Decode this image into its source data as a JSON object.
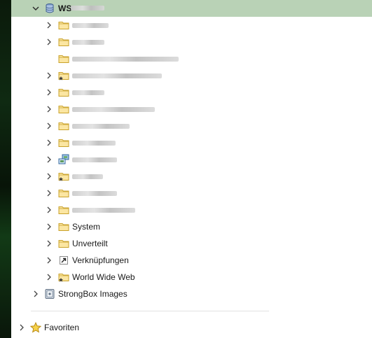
{
  "tree": {
    "root": {
      "label": "WS",
      "icon": "database-icon",
      "expanded": true
    },
    "children": [
      {
        "icon": "folder-icon",
        "has_chevron": true
      },
      {
        "icon": "folder-icon",
        "has_chevron": true
      },
      {
        "icon": "folder-icon",
        "has_chevron": false
      },
      {
        "icon": "folder-starred-icon",
        "has_chevron": true
      },
      {
        "icon": "folder-icon",
        "has_chevron": true
      },
      {
        "icon": "folder-icon",
        "has_chevron": true
      },
      {
        "icon": "folder-icon",
        "has_chevron": true
      },
      {
        "icon": "folder-icon",
        "has_chevron": true
      },
      {
        "icon": "network-icon",
        "has_chevron": true
      },
      {
        "icon": "folder-starred-icon",
        "has_chevron": true
      },
      {
        "icon": "folder-icon",
        "has_chevron": true
      },
      {
        "icon": "folder-icon",
        "has_chevron": true
      },
      {
        "label": "System",
        "icon": "folder-icon",
        "has_chevron": true
      },
      {
        "label": "Unverteilt",
        "icon": "folder-icon",
        "has_chevron": true
      },
      {
        "label": "Verknüpfungen",
        "icon": "shortcut-icon",
        "has_chevron": true
      },
      {
        "label": "World Wide Web",
        "icon": "folder-starred-icon",
        "has_chevron": true
      }
    ],
    "images": {
      "label": "StrongBox Images",
      "icon": "strongbox-icon"
    },
    "favorites": {
      "label": "Favoriten",
      "icon": "star-icon"
    }
  },
  "colors": {
    "selection": "#b9d2b6",
    "folder": "#f2c94c",
    "folder_stroke": "#c9a22b"
  }
}
